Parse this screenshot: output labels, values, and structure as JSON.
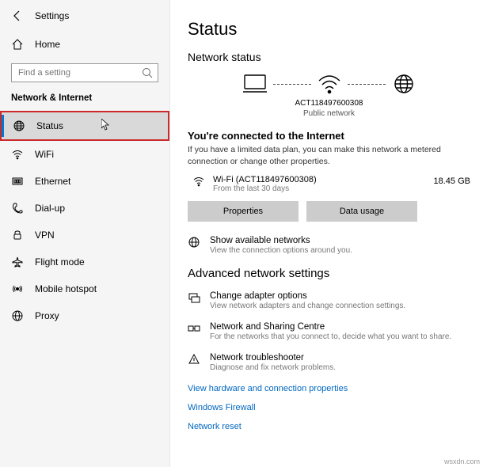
{
  "app": {
    "title": "Settings"
  },
  "sidebar": {
    "home": "Home",
    "search_placeholder": "Find a setting",
    "section": "Network & Internet",
    "items": [
      {
        "label": "Status"
      },
      {
        "label": "WiFi"
      },
      {
        "label": "Ethernet"
      },
      {
        "label": "Dial-up"
      },
      {
        "label": "VPN"
      },
      {
        "label": "Flight mode"
      },
      {
        "label": "Mobile hotspot"
      },
      {
        "label": "Proxy"
      }
    ]
  },
  "main": {
    "title": "Status",
    "network_status_title": "Network status",
    "diagram": {
      "ssid": "ACT118497600308",
      "type": "Public network"
    },
    "connected_title": "You're connected to the Internet",
    "connected_desc": "If you have a limited data plan, you can make this network a metered connection or change other properties.",
    "connection": {
      "name": "Wi-Fi (ACT118497600308)",
      "sub": "From the last 30 days",
      "usage": "18.45 GB"
    },
    "buttons": {
      "properties": "Properties",
      "data_usage": "Data usage"
    },
    "available": {
      "title": "Show available networks",
      "desc": "View the connection options around you."
    },
    "advanced_title": "Advanced network settings",
    "adapter": {
      "title": "Change adapter options",
      "desc": "View network adapters and change connection settings."
    },
    "sharing": {
      "title": "Network and Sharing Centre",
      "desc": "For the networks that you connect to, decide what you want to share."
    },
    "troubleshooter": {
      "title": "Network troubleshooter",
      "desc": "Diagnose and fix network problems."
    },
    "links": {
      "hardware": "View hardware and connection properties",
      "firewall": "Windows Firewall",
      "reset": "Network reset"
    }
  },
  "watermark": "wsxdn.com"
}
